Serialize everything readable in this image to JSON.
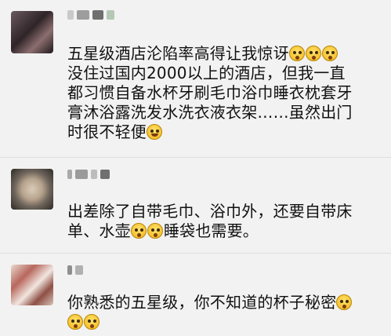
{
  "comments": [
    {
      "lines": [
        "五星级酒店沦陷率高得让我惊讶",
        "没住过国内2000以上的酒店，但我一直",
        "都习惯自备水杯牙刷毛巾浴巾睡衣枕套牙",
        "膏沐浴露洗发水洗衣液衣架……虽然出门",
        "时很不轻便"
      ],
      "emojis": [
        "shocked-emoji-icon",
        "shocked-emoji-icon",
        "shocked-emoji-icon",
        "laughing-crying-emoji-icon"
      ]
    },
    {
      "lines": [
        "出差除了自带毛巾、浴巾外，还要自带床",
        "单、水壶",
        "睡袋也需要。"
      ],
      "emojis": [
        "shocked-emoji-icon",
        "shocked-emoji-icon"
      ]
    },
    {
      "lines": [
        "你熟悉的五星级，你不知道的杯子秘密"
      ],
      "emojis": [
        "shocked-emoji-icon",
        "shocked-emoji-icon",
        "shocked-emoji-icon"
      ]
    }
  ],
  "colors": {
    "background": "#f2f2f2",
    "text": "#111111",
    "emoji": "#f6c12e"
  }
}
